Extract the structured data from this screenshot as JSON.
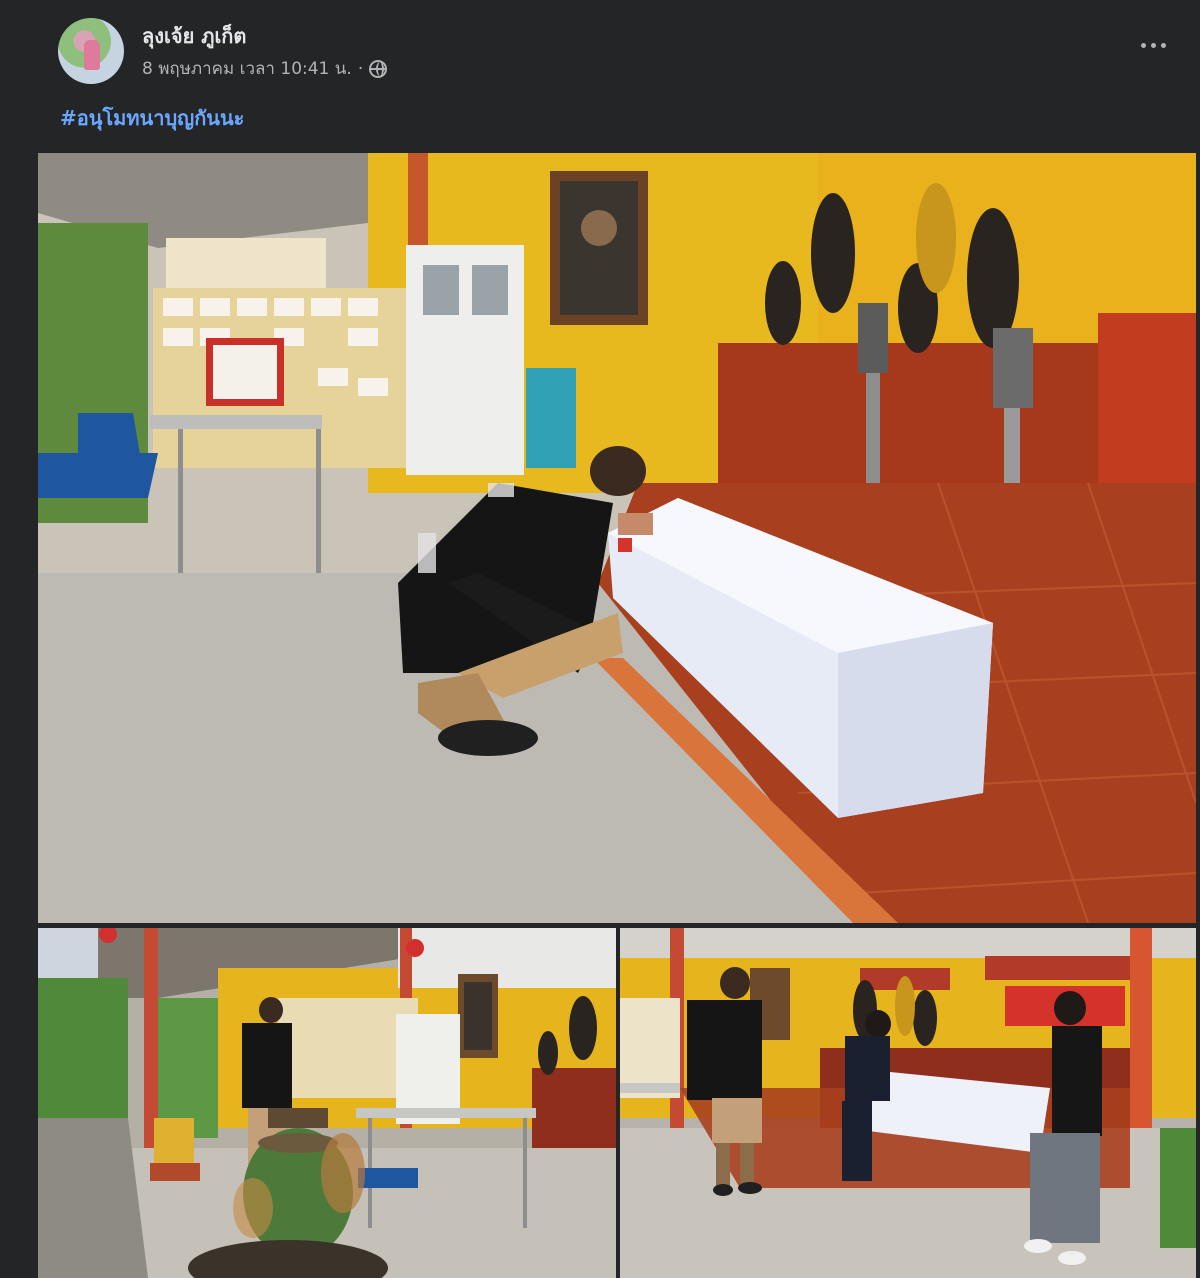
{
  "post": {
    "author": "ลุงเจ้ย ภูเก็ต",
    "timestamp": "8 พฤษภาคม เวลา 10:41 น.",
    "separator": "·",
    "privacy_icon": "globe-icon",
    "more_icon": "more-options-icon",
    "hashtag": "#อนุโมทนาบุญกันนะ"
  },
  "photos": [
    {
      "name": "main-photo",
      "description_icon": "photo"
    },
    {
      "name": "photo-2",
      "description_icon": "photo"
    },
    {
      "name": "photo-3",
      "description_icon": "photo"
    }
  ],
  "colors": {
    "background": "#242526",
    "text_primary": "#e4e6eb",
    "text_secondary": "#b0b3b8",
    "link": "#6ba7ff",
    "wall_yellow": "#e8b81f",
    "floor_red": "#a8401f",
    "coffin_white": "#eef1f8"
  }
}
